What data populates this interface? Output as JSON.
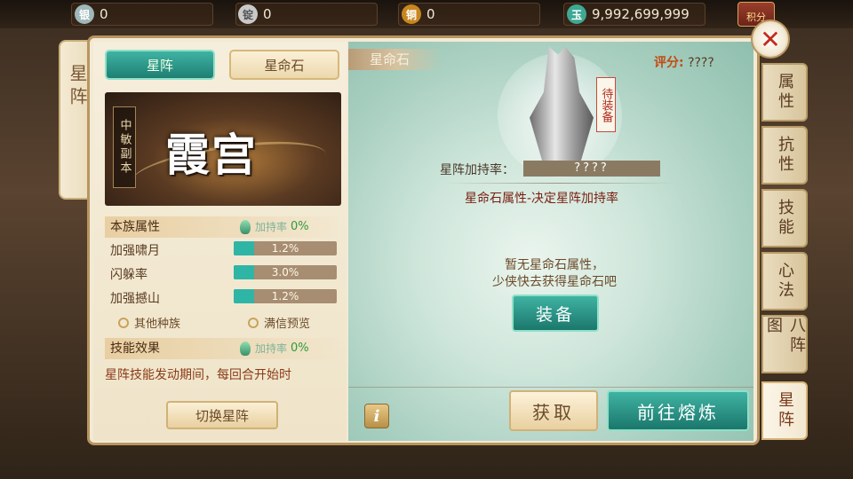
{
  "currencies": [
    {
      "icon": "silver-coin-icon",
      "glyph": "银",
      "value": "0",
      "color": "#9fb7b8"
    },
    {
      "icon": "ingot-icon",
      "glyph": "锭",
      "value": "0",
      "color": "#c9c9c9"
    },
    {
      "icon": "copper-coin-icon",
      "glyph": "铜",
      "value": "0",
      "color": "#c8871e"
    },
    {
      "icon": "jade-icon",
      "glyph": "玉",
      "value": "9,992,699,999",
      "color": "#3ea893"
    }
  ],
  "jifen_label": "积分",
  "left_tab": "星阵",
  "tabs": {
    "active": "星阵",
    "inactive": "星命石"
  },
  "banner": {
    "vertical_tag": "中敏副本",
    "title": "霞宫"
  },
  "clan_attr": {
    "title": "本族属性",
    "rate_label": "加持率",
    "rate_value": "0%"
  },
  "stats": [
    {
      "label": "加强啸月",
      "value": "1.2%",
      "fill": 0.2
    },
    {
      "label": "闪躲率",
      "value": "3.0%",
      "fill": 0.2
    },
    {
      "label": "加强撼山",
      "value": "1.2%",
      "fill": 0.2
    }
  ],
  "links": {
    "other_clans": "其他种族",
    "max_preview": "满信预览"
  },
  "skill_effect": {
    "title": "技能效果",
    "rate_label": "加持率",
    "rate_value": "0%",
    "desc": "星阵技能发动期间，每回合开始时"
  },
  "switch_button": "切换星阵",
  "right": {
    "tag": "星命石",
    "score_label": "评分:",
    "score_value": "????",
    "pending": "待装备",
    "bonus_label": "星阵加持率：",
    "bonus_value": "????",
    "stone_attr": "星命石属性-决定星阵加持率",
    "empty_line1": "暂无星命石属性，",
    "empty_line2": "少侠快去获得星命石吧",
    "equip": "装备",
    "info": "i",
    "get": "获取",
    "forge": "前往熔炼"
  },
  "right_tabs": [
    "属性",
    "抗性",
    "技能",
    "心法",
    "八阵图",
    "星阵"
  ],
  "close_icon": "close-icon"
}
